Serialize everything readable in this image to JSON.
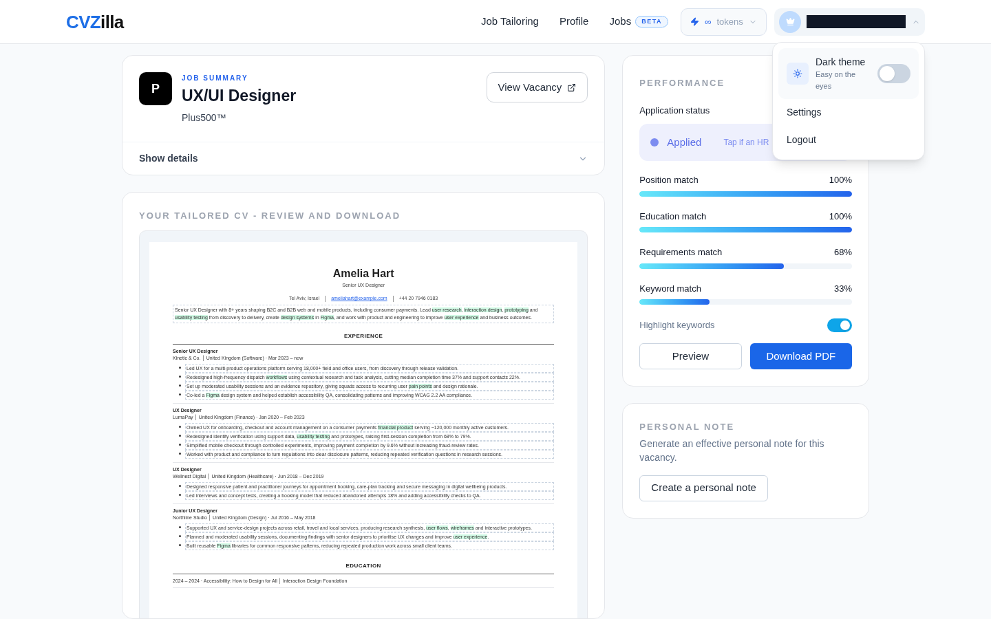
{
  "header": {
    "logo": {
      "accent": "CVZ",
      "rest": "illa"
    },
    "nav": [
      {
        "label": "Job Tailoring"
      },
      {
        "label": "Profile"
      },
      {
        "label": "Jobs",
        "badge": "BETA"
      }
    ],
    "tokens": {
      "amount": "∞",
      "label": "tokens"
    },
    "account": {
      "menu_expanded": true
    }
  },
  "account_menu": {
    "theme": {
      "title": "Dark theme",
      "subtitle": "Easy on the eyes",
      "on": false
    },
    "items": [
      "Settings",
      "Logout"
    ]
  },
  "job_summary": {
    "avatar": "P",
    "eyebrow": "JOB SUMMARY",
    "title": "UX/UI Designer",
    "company": "Plus500™",
    "button": "View Vacancy",
    "details": "Show details",
    "expanded": false
  },
  "cv": {
    "heading": "YOUR TAILORED CV - REVIEW AND DOWNLOAD",
    "name": "Amelia Hart",
    "role": "Senior UX Designer",
    "contact": [
      {
        "text": "Tel Aviv, Israel",
        "kind": "text"
      },
      {
        "text": "ameliahart@example.com",
        "kind": "link"
      },
      {
        "text": "+44 20 7946 0183",
        "kind": "text"
      }
    ],
    "summary": [
      {
        "text": "Senior UX Designer with 8+ years shaping B2C and B2B web and mobile products, including consumer payments. Lead ",
        "highlighted": false
      },
      {
        "text": "user research",
        "highlighted": true
      },
      {
        "text": ", ",
        "highlighted": false
      },
      {
        "text": "interaction design",
        "highlighted": true
      },
      {
        "text": ", ",
        "highlighted": false
      },
      {
        "text": "prototyping",
        "highlighted": true
      },
      {
        "text": " and ",
        "highlighted": false
      },
      {
        "text": "usability testing",
        "highlighted": true
      },
      {
        "text": " from discovery to delivery, create ",
        "highlighted": false
      },
      {
        "text": "design systems",
        "highlighted": true
      },
      {
        "text": " in ",
        "highlighted": false
      },
      {
        "text": "Figma",
        "highlighted": true
      },
      {
        "text": ", and work with product and engineering to improve ",
        "highlighted": false
      },
      {
        "text": "user experience",
        "highlighted": true
      },
      {
        "text": " and business outcomes.",
        "highlighted": false
      }
    ],
    "experience_heading": "EXPERIENCE",
    "jobs": [
      {
        "title": "Senior UX Designer",
        "meta": "Kinetic & Co. │ United Kingdom (Software) · Mar 2023 – now",
        "bullets": [
          [
            {
              "text": "Led UX for a multi-product operations platform serving 18,000+ field and office users, from discovery through release validation.",
              "highlighted": false
            }
          ],
          [
            {
              "text": "Redesigned high-frequency dispatch ",
              "highlighted": false
            },
            {
              "text": "workflows",
              "highlighted": true
            },
            {
              "text": " using contextual research and task analysis, cutting median completion time 37% and support contacts 22%.",
              "highlighted": false
            }
          ],
          [
            {
              "text": "Set up moderated usability sessions and an evidence repository, giving squads access to recurring user ",
              "highlighted": false
            },
            {
              "text": "pain points",
              "highlighted": true
            },
            {
              "text": " and design rationale.",
              "highlighted": false
            }
          ],
          [
            {
              "text": "Co-led a ",
              "highlighted": false
            },
            {
              "text": "Figma",
              "highlighted": true
            },
            {
              "text": " design system and helped establish accessibility QA, consolidating patterns and improving WCAG 2.2 AA compliance.",
              "highlighted": false
            }
          ]
        ]
      },
      {
        "title": "UX Designer",
        "meta": "LumaPay │ United Kingdom (Finance) · Jan 2020 – Feb 2023",
        "bullets": [
          [
            {
              "text": "Owned UX for onboarding, checkout and account management on a consumer payments ",
              "highlighted": false
            },
            {
              "text": "financial product",
              "highlighted": true
            },
            {
              "text": " serving ~120,000 monthly active customers.",
              "highlighted": false
            }
          ],
          [
            {
              "text": "Redesigned identity verification using support data, ",
              "highlighted": false
            },
            {
              "text": "usability testing",
              "highlighted": true
            },
            {
              "text": " and prototypes, raising first-session completion from 68% to 79%.",
              "highlighted": false
            }
          ],
          [
            {
              "text": "Simplified mobile checkout through controlled experiments, improving payment completion by 9.6% without increasing fraud-review rates.",
              "highlighted": false
            }
          ],
          [
            {
              "text": "Worked with product and compliance to turn regulations into clear disclosure patterns, reducing repeated verification questions in research sessions.",
              "highlighted": false
            }
          ]
        ]
      },
      {
        "title": "UX Designer",
        "meta": "Wellnest Digital │ United Kingdom (Healthcare) · Jun 2018 – Dec 2019",
        "bullets": [
          [
            {
              "text": "Designed responsive patient and practitioner journeys for appointment booking, care-plan tracking and secure messaging in digital wellbeing products.",
              "highlighted": false
            }
          ],
          [
            {
              "text": "Led interviews and concept tests, creating a booking model that reduced abandoned attempts 18% and adding accessibility checks to QA.",
              "highlighted": false
            }
          ]
        ]
      },
      {
        "title": "Junior UX Designer",
        "meta": "Northline Studio │ United Kingdom (Design) · Jul 2016 – May 2018",
        "bullets": [
          [
            {
              "text": "Supported UX and service-design projects across retail, travel and local services, producing research synthesis, ",
              "highlighted": false
            },
            {
              "text": "user flows",
              "highlighted": true
            },
            {
              "text": ", ",
              "highlighted": false
            },
            {
              "text": "wireframes",
              "highlighted": true
            },
            {
              "text": " and interactive prototypes.",
              "highlighted": false
            }
          ],
          [
            {
              "text": "Planned and moderated usability sessions, documenting findings with senior designers to prioritise UX changes and improve ",
              "highlighted": false
            },
            {
              "text": "user experience",
              "highlighted": true
            },
            {
              "text": ".",
              "highlighted": false
            }
          ],
          [
            {
              "text": "Built reusable ",
              "highlighted": false
            },
            {
              "text": "Figma",
              "highlighted": true
            },
            {
              "text": " libraries for common responsive patterns, reducing repeated production work across small client teams.",
              "highlighted": false
            }
          ]
        ]
      }
    ],
    "education_heading": "EDUCATION",
    "education": [
      "2024 – 2024 · Accessibility: How to Design for All │ Interaction Design Foundation"
    ]
  },
  "performance": {
    "heading": "PERFORMANCE",
    "status_label": "Application status",
    "status": "Applied",
    "status_hint": "Tap if an HR",
    "metrics": [
      {
        "label": "Position match",
        "value": "100%",
        "level": 1
      },
      {
        "label": "Education match",
        "value": "100%",
        "level": 1
      },
      {
        "label": "Requirements match",
        "value": "68%",
        "level": 0.68
      },
      {
        "label": "Keyword match",
        "value": "33%",
        "level": 0.33
      }
    ],
    "highlight_keywords": {
      "label": "Highlight keywords",
      "on": true
    },
    "buttons": [
      {
        "label": "Preview",
        "kind": "secondary"
      },
      {
        "label": "Download PDF",
        "kind": "primary"
      }
    ]
  },
  "personal_note": {
    "heading": "PERSONAL NOTE",
    "text": "Generate an effective personal note for this vacancy.",
    "button": "Create a personal note"
  }
}
